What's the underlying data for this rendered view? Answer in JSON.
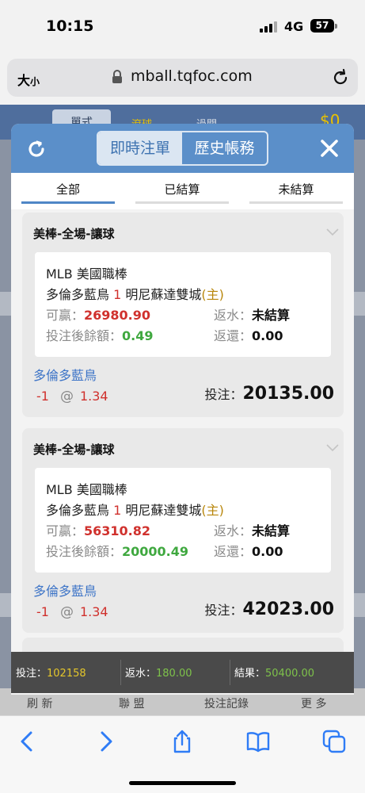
{
  "status": {
    "time": "10:15",
    "network": "4G",
    "battery": "57"
  },
  "browser": {
    "aa_label": "大",
    "aa_small": "小",
    "url": "mball.tqfoc.com"
  },
  "background": {
    "tab_single": "單式",
    "tab_rolling": "滾球",
    "tab_parlay": "過關",
    "balance": "$0",
    "footer": [
      "刷 新",
      "聯 盟",
      "投注記錄",
      "更 多"
    ]
  },
  "modal": {
    "seg_live": "即時注單",
    "seg_history": "歷史帳務",
    "tabs": [
      "全部",
      "已結算",
      "未結算"
    ],
    "labels": {
      "win": "可贏：",
      "balance_after": "投注後餘額：",
      "rebate": "返水：",
      "refund": "返還：",
      "stake": "投注："
    },
    "bets": [
      {
        "title": "美棒-全場-讓球",
        "league": "MLB 美國職棒",
        "team_home": "多倫多藍鳥",
        "handicap": "1",
        "team_away": "明尼蘇達雙城",
        "home_mark": "(主)",
        "win": "26980.90",
        "balance_after": "0.49",
        "rebate": "未結算",
        "refund": "0.00",
        "pick": "多倫多藍鳥",
        "line": "-1",
        "at": "@",
        "odds": "1.34",
        "stake": "20135.00"
      },
      {
        "title": "美棒-全場-讓球",
        "league": "MLB 美國職棒",
        "team_home": "多倫多藍鳥",
        "handicap": "1",
        "team_away": "明尼蘇達雙城",
        "home_mark": "(主)",
        "win": "56310.82",
        "balance_after": "20000.49",
        "rebate": "未結算",
        "refund": "0.00",
        "pick": "多倫多藍鳥",
        "line": "-1",
        "at": "@",
        "odds": "1.34",
        "stake": "42023.00"
      }
    ]
  },
  "summary": {
    "stake_label": "投注：",
    "stake": "102158",
    "rebate_label": "返水：",
    "rebate": "180.00",
    "result_label": "結果：",
    "result": "50400.00"
  },
  "colors": {
    "header_blue": "#5b8fc9",
    "win_red": "#d0312d",
    "balance_green": "#3fa83f",
    "link_blue": "#3d74c7",
    "summary_yellow": "#e4c62b"
  }
}
